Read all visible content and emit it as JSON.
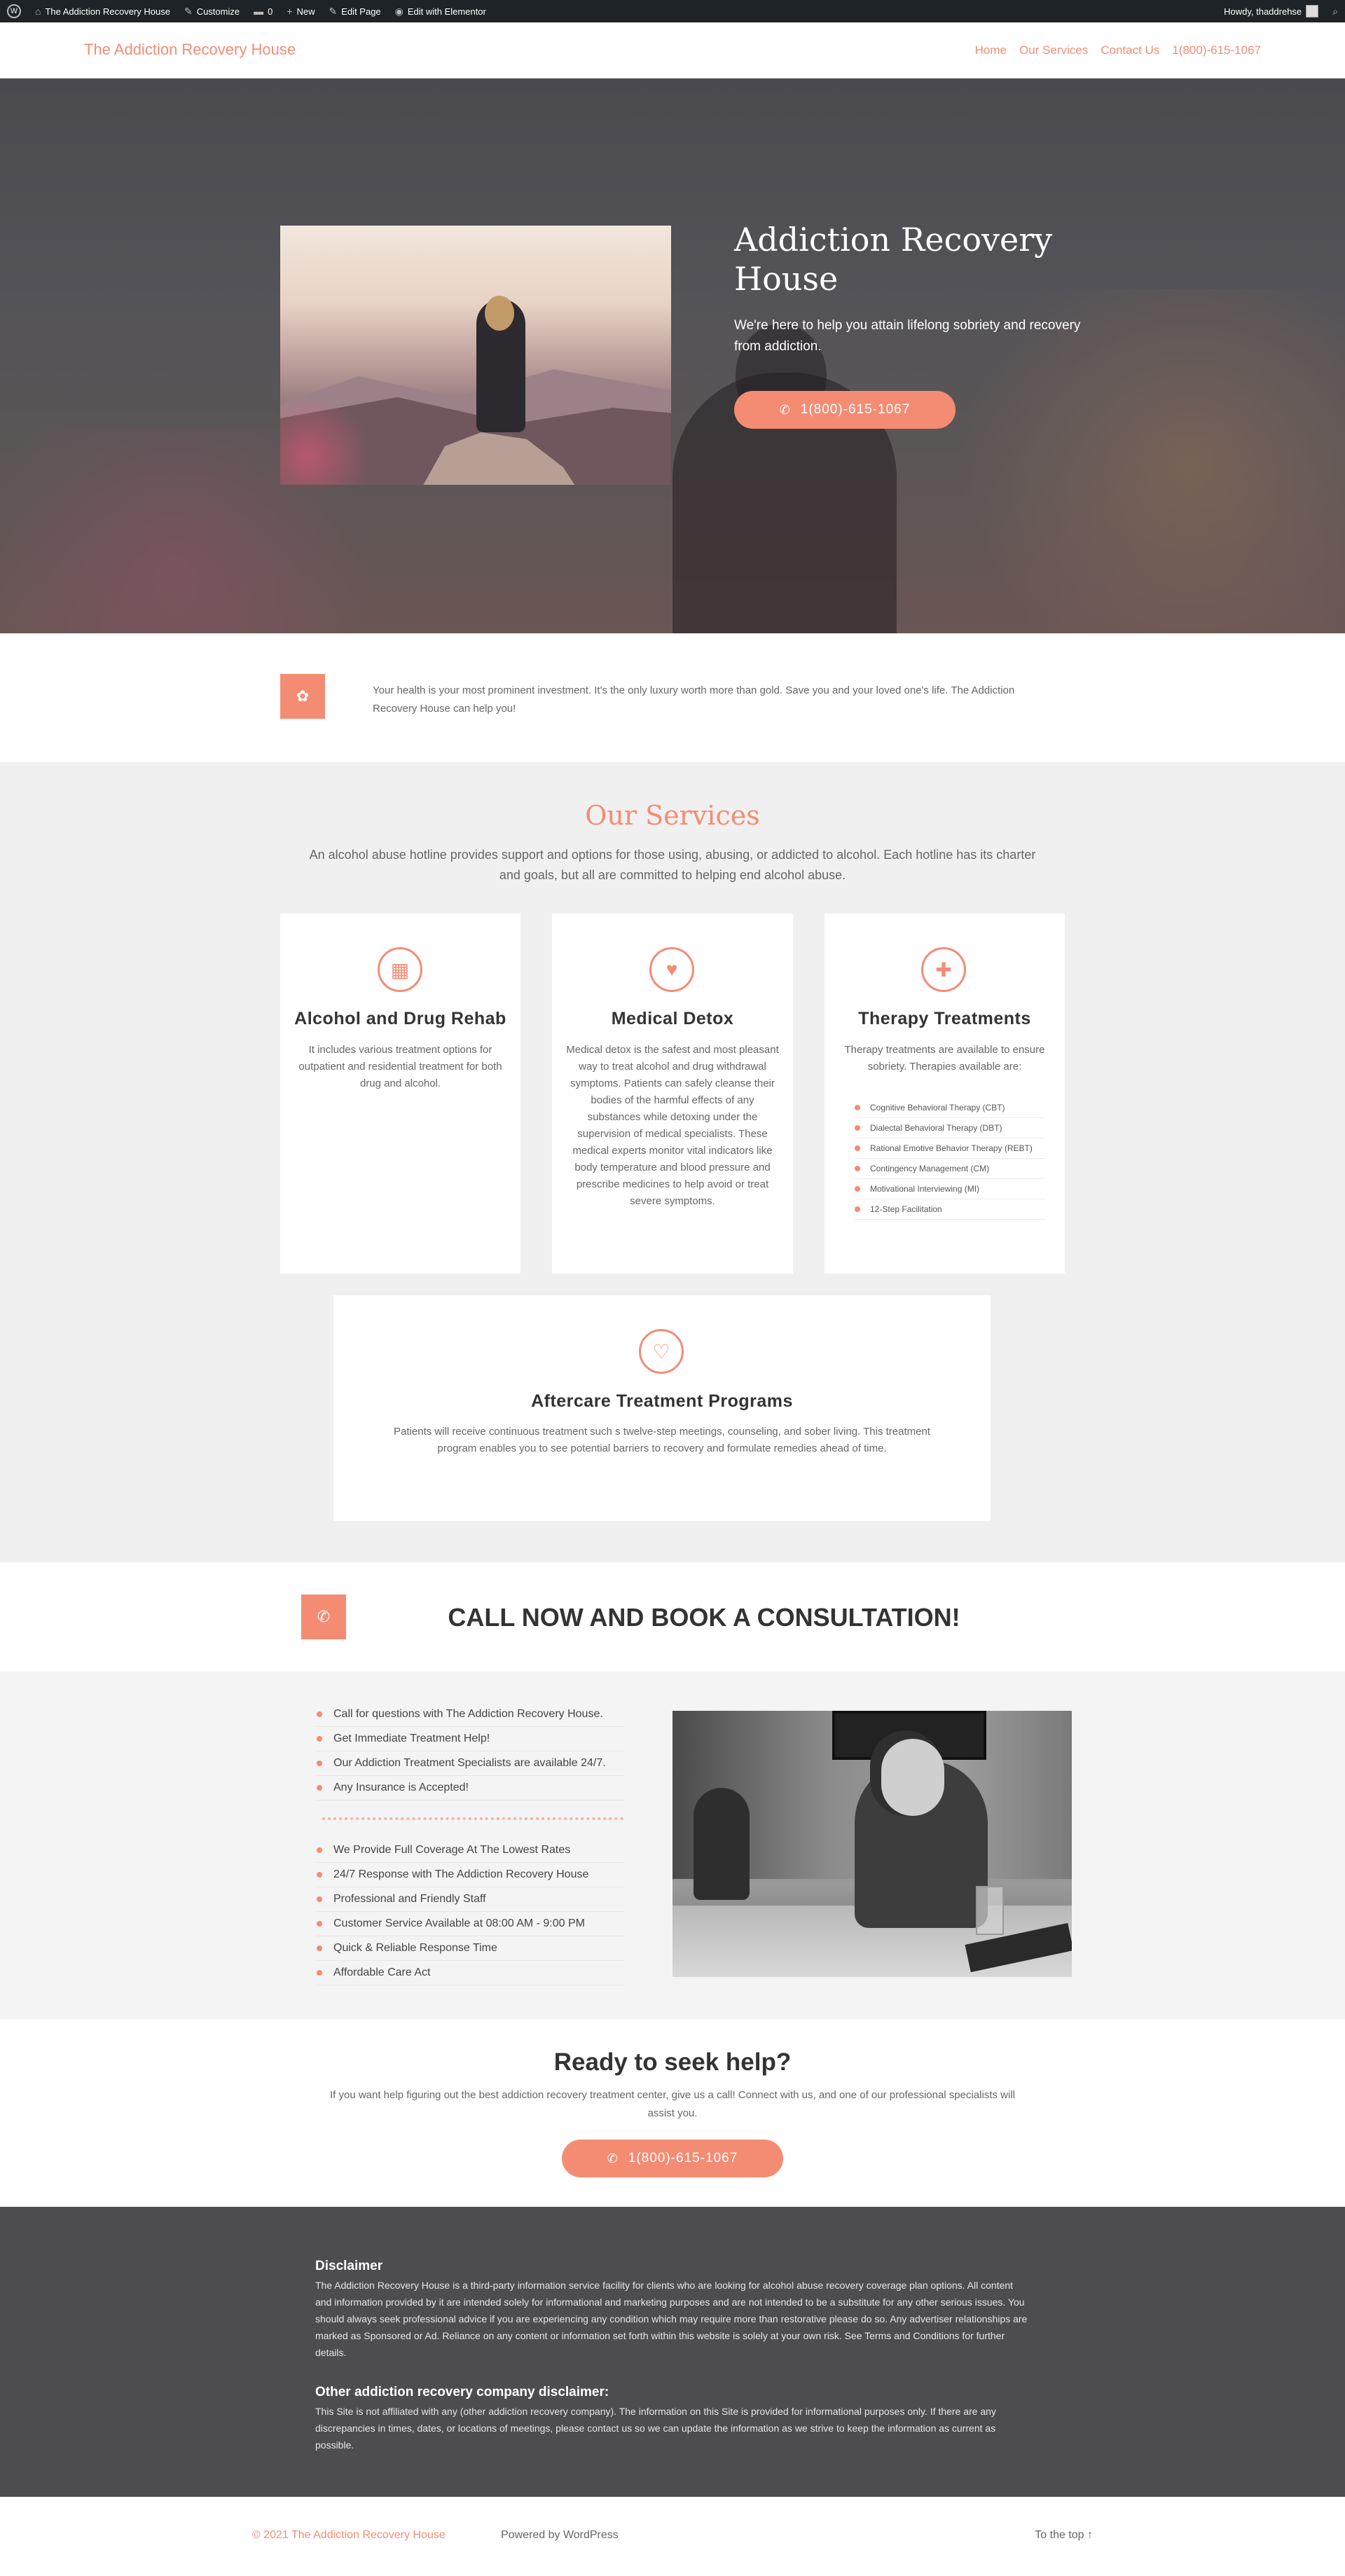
{
  "admin_bar": {
    "site_name": "The Addiction Recovery House",
    "customize": "Customize",
    "comments_count": "0",
    "new": "New",
    "edit_page": "Edit Page",
    "edit_elementor": "Edit with Elementor",
    "howdy": "Howdy, thaddrehse"
  },
  "header": {
    "site_title": "The Addiction Recovery House",
    "nav": [
      "Home",
      "Our Services",
      "Contact Us",
      "1(800)-615-1067"
    ]
  },
  "hero": {
    "title": "Addiction Recovery House",
    "subtitle": "We're here to help you attain lifelong sobriety and recovery from addiction.",
    "button_label": "1(800)-615-1067"
  },
  "intro": {
    "text": "Your health is your most prominent investment. It's the only luxury worth more than gold. Save you and your loved one's life. The Addiction Recovery House can help you!"
  },
  "services": {
    "title": "Our Services",
    "subtitle": "An alcohol abuse hotline provides support and options for those using, abusing, or addicted to alcohol. Each hotline has its charter and goals, but all are committed to helping end alcohol abuse.",
    "cards": [
      {
        "icon": "hospital-icon",
        "title": "Alcohol and Drug Rehab",
        "text": "It includes various treatment options for outpatient and residential treatment for both drug and alcohol."
      },
      {
        "icon": "heart-hand-icon",
        "title": "Medical Detox",
        "text": "Medical detox is the safest and most pleasant way to treat alcohol and drug withdrawal symptoms. Patients can safely cleanse their bodies of the harmful effects of any substances while detoxing under the supervision of medical specialists. These medical experts monitor vital indicators like body temperature and blood pressure and prescribe medicines to help avoid or treat severe symptoms."
      },
      {
        "icon": "medical-file-icon",
        "title": "Therapy Treatments",
        "text": "Therapy treatments are available to ensure sobriety. Therapies available are:",
        "list": [
          "Cognitive Behavioral Therapy (CBT)",
          "Dialectal Behavioral Therapy (DBT)",
          "Rational Emotive Behavior Therapy (REBT)",
          "Contingency Management (CM)",
          "Motivational Interviewing (MI)",
          "12-Step Facilitation"
        ]
      },
      {
        "icon": "heartbeat-icon",
        "title": "Aftercare Treatment Programs",
        "text": "Patients will receive continuous treatment such s twelve-step meetings, counseling, and sober living. This treatment program enables you to see potential barriers to recovery and formulate remedies ahead of time."
      }
    ]
  },
  "cta": {
    "title": "CALL NOW AND BOOK A CONSULTATION!"
  },
  "features": {
    "list_top": [
      "Call for questions with The Addiction Recovery House.",
      "Get Immediate Treatment Help!",
      "Our Addiction Treatment Specialists are available 24/7.",
      "Any Insurance is Accepted!"
    ],
    "list_bottom": [
      "We Provide Full Coverage At The Lowest Rates",
      "24/7 Response with The Addiction Recovery House",
      "Professional and Friendly Staff",
      "Customer Service Available at 08:00 AM - 9:00 PM",
      "Quick & Reliable Response Time",
      "Affordable Care Act"
    ]
  },
  "ready": {
    "title": "Ready to seek help?",
    "text": "If you want help figuring out the best addiction recovery treatment center, give us a call! Connect with us, and one of our professional specialists will assist you.",
    "button_label": "1(800)-615-1067"
  },
  "disclaimer": {
    "heading1": "Disclaimer",
    "text1": "The Addiction Recovery House is a third-party information service facility for clients who are looking for alcohol abuse recovery coverage plan options. All content and information provided by it are intended solely for informational and marketing purposes and are not intended to be a substitute for any other serious issues. You should always seek professional advice if you are experiencing any condition which may require more than restorative please do so. Any advertiser relationships are marked as Sponsored or Ad. Reliance on any content or information set forth within this website is solely at your own risk. See Terms and Conditions for further details.",
    "heading2": "Other addiction recovery company disclaimer:",
    "text2": "This Site is not affiliated with any (other addiction recovery company). The information on this Site is provided for informational purposes only. If there are any discrepancies in times, dates, or locations of meetings, please contact us so we can update the information as we strive to keep the information as current as possible."
  },
  "footer": {
    "copyright": "© 2021 The Addiction Recovery House",
    "powered": "Powered by WordPress",
    "to_top": "To the top ↑"
  },
  "colors": {
    "accent": "#f48c74",
    "admin_bar": "#1d2327",
    "disclaimer_bg": "#4d4d4f"
  }
}
